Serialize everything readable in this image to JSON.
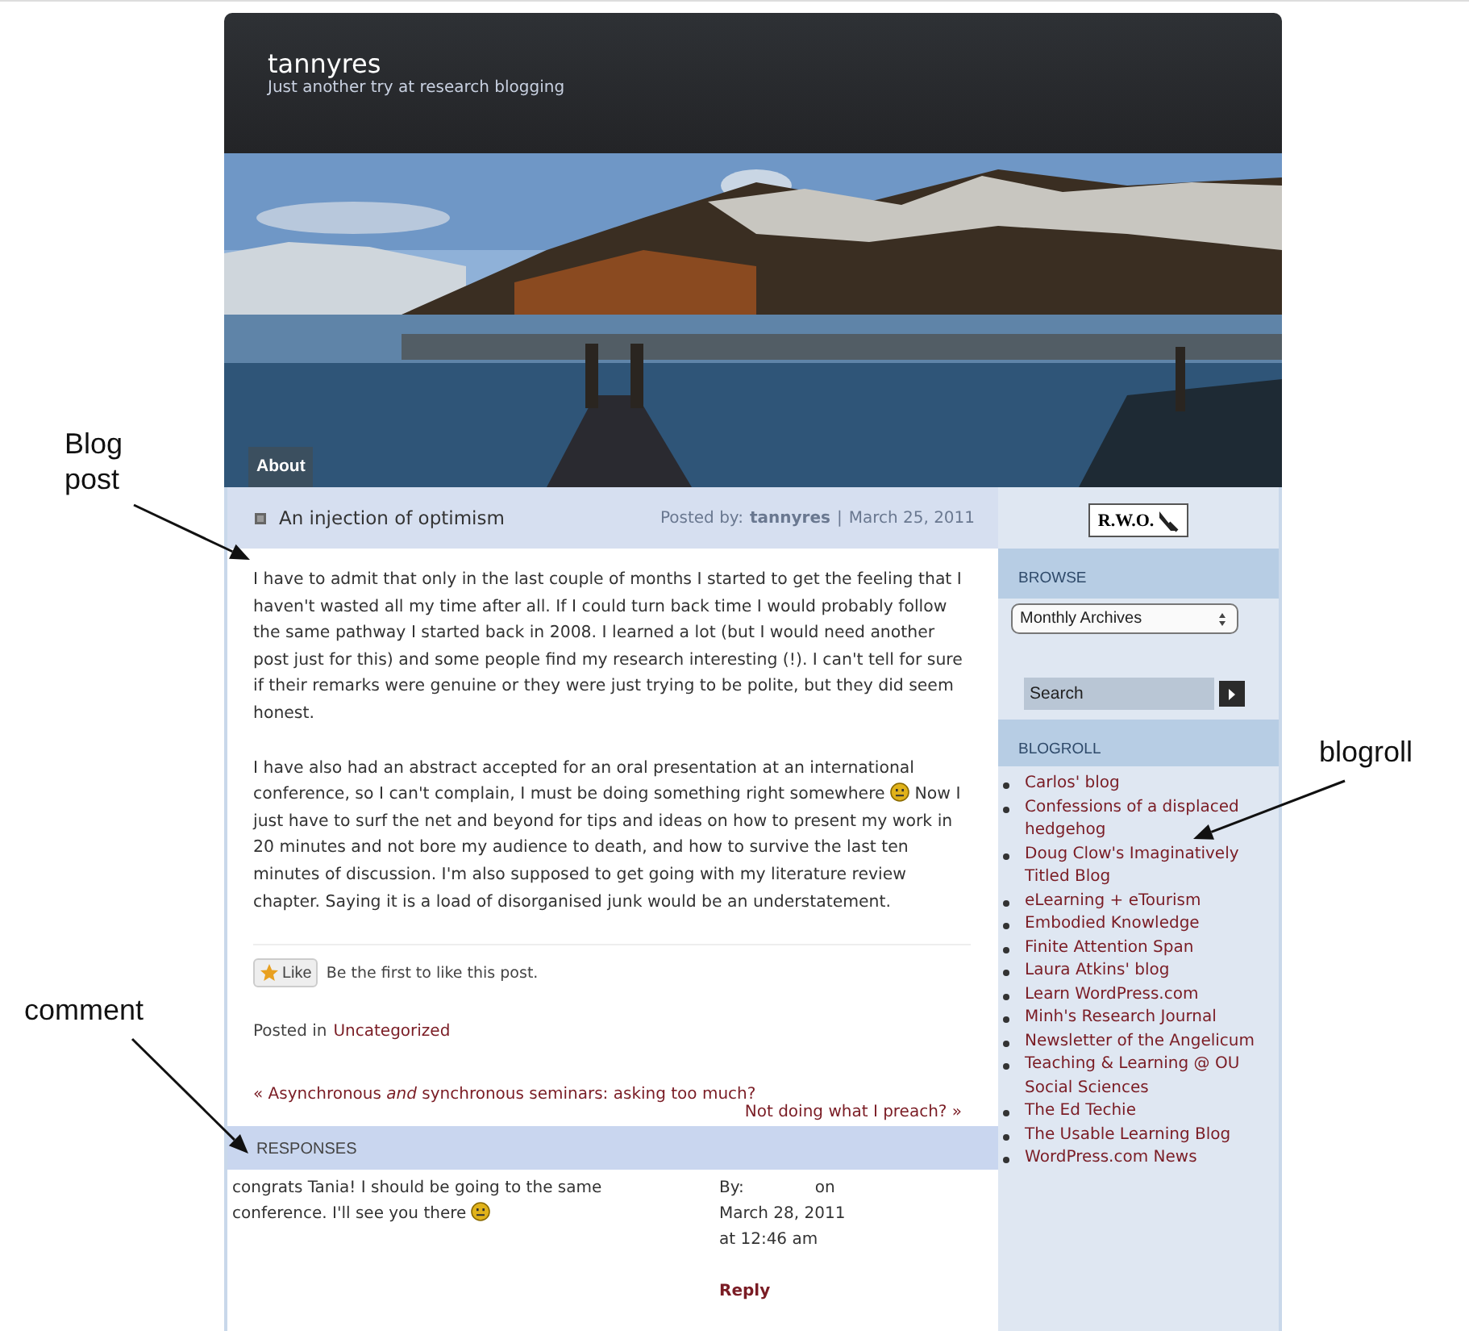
{
  "blog": {
    "title": "tannyres",
    "tagline": "Just another try at research blogging"
  },
  "nav_tabs": [
    {
      "label": "About",
      "selected": false
    }
  ],
  "post": {
    "title": "An injection of optimism",
    "meta_label": "Posted by:",
    "author": "tannyres",
    "separator": "|",
    "date": "March 25, 2011",
    "paragraphs": [
      {
        "segments": [
          {
            "kind": "text",
            "text": "I have to admit that only in the last couple of months I started to get the feeling that I haven't wasted all my time after all. If I could turn back time I would probably follow the same pathway I started back in 2008. I learned a lot (but I would need another post just for this) and some people find my research interesting (!). I can't tell for sure if their remarks were genuine or they were just trying to be polite, but they did seem honest."
          }
        ]
      },
      {
        "segments": [
          {
            "kind": "text",
            "text": "I have also had an abstract accepted for an oral presentation at an international conference, so I can't complain, I must be doing something right somewhere "
          },
          {
            "kind": "smiley"
          },
          {
            "kind": "text",
            "text": " Now I just have to surf the net and beyond for tips and ideas on how to present my work in 20 minutes and not bore my audience to death, and how to survive the last ten minutes of discussion. I'm also supposed to get going with my literature review chapter. Saying it is a load of disorganised junk would be an understatement."
          }
        ]
      }
    ],
    "like_button": "Like",
    "like_text": "Be the first to like this post.",
    "category_label": "Posted in",
    "category": "Uncategorized",
    "prev_link": "« Asynchronous *and* synchronous seminars: asking too much?",
    "next_link": "Not doing what I preach? »"
  },
  "responses": {
    "heading": "RESPONSES",
    "comments": [
      {
        "segments": [
          {
            "kind": "text",
            "text": "congrats Tania! I should be going to the same conference. I'll see you there "
          },
          {
            "kind": "smiley"
          }
        ],
        "by_label": "By:",
        "on_label": "on",
        "date": "March 28, 2011",
        "time": "at 12:46 am",
        "reply": "Reply"
      }
    ]
  },
  "sidebar": {
    "logo": "R.W.O.",
    "browse_heading": "BROWSE",
    "archive_select": "Monthly Archives",
    "search": {
      "placeholder": "Search"
    },
    "blogroll_heading": "BLOGROLL",
    "blogroll": [
      "Carlos' blog",
      "Confessions of a displaced hedgehog",
      "Doug Clow's Imaginatively Titled Blog",
      "eLearning + eTourism",
      "Embodied Knowledge",
      "Finite Attention Span",
      "Laura Atkins' blog",
      "Learn WordPress.com",
      "Minh's Research Journal",
      "Newsletter of the Angelicum",
      "Teaching & Learning @ OU Social Sciences",
      "The Ed Techie",
      "The Usable Learning Blog",
      "WordPress.com News"
    ]
  },
  "annotations": [
    {
      "label": "Blog post"
    },
    {
      "label": "blogroll"
    },
    {
      "label": "comment"
    }
  ]
}
